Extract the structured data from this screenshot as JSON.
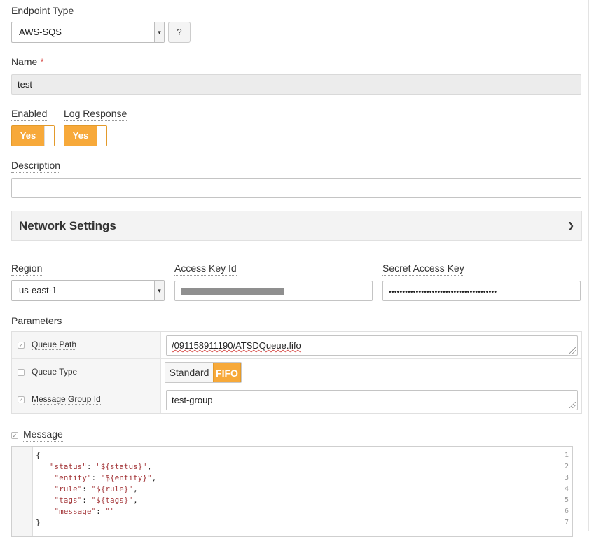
{
  "endpoint_type": {
    "label": "Endpoint Type",
    "value": "AWS-SQS",
    "help_label": "?"
  },
  "name": {
    "label": "Name",
    "required_mark": "*",
    "value": "test"
  },
  "enabled": {
    "label": "Enabled",
    "value": "Yes"
  },
  "log_response": {
    "label": "Log Response",
    "value": "Yes"
  },
  "description": {
    "label": "Description",
    "value": ""
  },
  "network_settings": {
    "title": "Network Settings"
  },
  "region": {
    "label": "Region",
    "value": "us-east-1"
  },
  "access_key_id": {
    "label": "Access Key Id"
  },
  "secret_access_key": {
    "label": "Secret Access Key",
    "value": "••••••••••••••••••••••••••••••••••••••••"
  },
  "parameters": {
    "label": "Parameters",
    "rows": [
      {
        "label": "Queue Path",
        "checked": true,
        "value": "/091158911190/ATSDQueue.fifo"
      },
      {
        "label": "Queue Type",
        "checked": false,
        "options": [
          "Standard",
          "FIFO"
        ],
        "selected": "FIFO"
      },
      {
        "label": "Message Group Id",
        "checked": true,
        "value": "test-group"
      }
    ]
  },
  "message": {
    "label": "Message",
    "checked": true,
    "lines": [
      {
        "n": "1",
        "text": "{"
      },
      {
        "n": "2",
        "key": "\"status\"",
        "val": "\"${status}\""
      },
      {
        "n": "3",
        "key": "\"entity\"",
        "val": "\"${entity}\""
      },
      {
        "n": "4",
        "key": "\"rule\"",
        "val": "\"${rule}\""
      },
      {
        "n": "5",
        "key": "\"tags\"",
        "val": "\"${tags}\""
      },
      {
        "n": "6",
        "key": "\"message\"",
        "val": "\"\""
      },
      {
        "n": "7",
        "text": "}"
      }
    ]
  },
  "colors": {
    "accent": "#f7a93a",
    "required": "#d9534f",
    "panel_bg": "#f3f3f3"
  }
}
